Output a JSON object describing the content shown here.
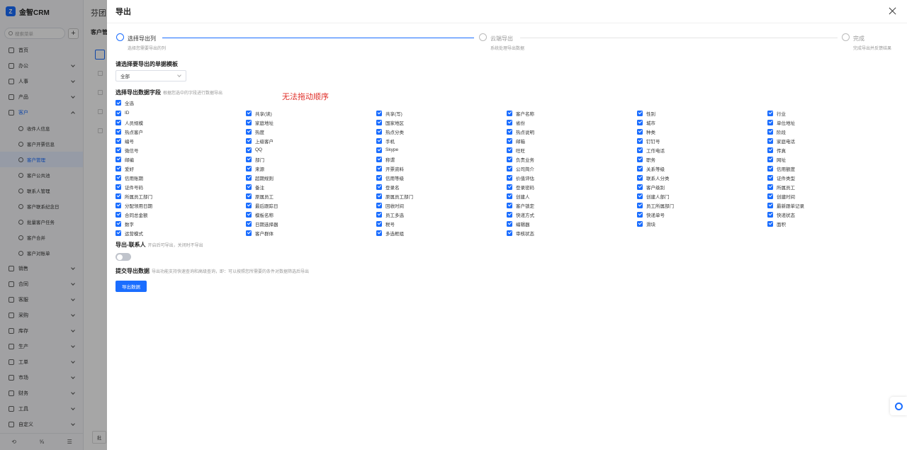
{
  "app": {
    "name": "金智CRM",
    "logo_text": "Z"
  },
  "sidebar": {
    "search_placeholder": "搜索菜单",
    "add_label": "+",
    "items": [
      {
        "label": "首页",
        "icon": "home-icon",
        "children": false,
        "expanded": false
      },
      {
        "label": "办公",
        "icon": "office-icon",
        "children": true,
        "expanded": false
      },
      {
        "label": "人事",
        "icon": "user-icon",
        "children": true,
        "expanded": false
      },
      {
        "label": "产品",
        "icon": "box-icon",
        "children": true,
        "expanded": false
      },
      {
        "label": "客户",
        "icon": "customer-icon",
        "children": true,
        "expanded": true,
        "active": true
      }
    ],
    "sub_items": [
      {
        "label": "收件人信息",
        "active": false
      },
      {
        "label": "客户开票信息",
        "active": false
      },
      {
        "label": "客户管理",
        "active": true
      },
      {
        "label": "客户公共池",
        "active": false
      },
      {
        "label": "联系人管理",
        "active": false
      },
      {
        "label": "客户联系纪念日",
        "active": false
      },
      {
        "label": "批量客户任务",
        "active": false
      },
      {
        "label": "客户合并",
        "active": false
      },
      {
        "label": "客户对账单",
        "active": false
      }
    ],
    "more_items": [
      "销售",
      "合同",
      "客服",
      "采购",
      "库存",
      "生产",
      "工单",
      "市场",
      "财务",
      "工具",
      "自定义"
    ],
    "bottom_icons": [
      "⟲",
      "⅝",
      "☰"
    ]
  },
  "background_page": {
    "title": "芬团",
    "subtitle": "客户管",
    "footer_btn": "批"
  },
  "drawer": {
    "title": "导出",
    "steps": [
      {
        "title": "选择导出列",
        "desc": "选择您需要导出的列",
        "status": "active"
      },
      {
        "title": "云端导出",
        "desc": "系统处理导出数据",
        "status": "wait"
      },
      {
        "title": "完成",
        "desc": "完成导出并反馈结果",
        "status": "wait"
      }
    ],
    "template_section": {
      "title": "请选择要导出的单据模板",
      "selected": "全部"
    },
    "fields_section": {
      "title": "选择导出数据字段",
      "hint": "根据您选中的字段进行数据导出",
      "select_all_label": "全选",
      "annotation": "无法拖动顺序",
      "fields": [
        "ID",
        "共享(读)",
        "共享(写)",
        "客户名称",
        "性别",
        "行业",
        "人员规模",
        "家庭地址",
        "国家地区",
        "省份",
        "城市",
        "单位地址",
        "热点客户",
        "热度",
        "热点分类",
        "热点说明",
        "种类",
        "阶段",
        "编号",
        "上级客户",
        "手机",
        "邮箱",
        "钉钉号",
        "家庭电话",
        "微信号",
        "QQ",
        "Skype",
        "旺旺",
        "工作电话",
        "传真",
        "邮编",
        "部门",
        "称谓",
        "负责业务",
        "职务",
        "网址",
        "爱好",
        "来源",
        "开票资料",
        "公司简介",
        "关系等级",
        "信用额度",
        "信用账期",
        "超期规则",
        "信用等级",
        "价值评估",
        "联系人分类",
        "证件类型",
        "证件号码",
        "备注",
        "登录名",
        "登录密码",
        "客户级别",
        "所属员工",
        "所属员工部门",
        "原属员工",
        "原属员工部门",
        "创建人",
        "创建人部门",
        "创建时间",
        "分配领用日期",
        "最后跟踪日",
        "回收时间",
        "客户锁定",
        "员工所属部门",
        "最新跟单记录",
        "合同总金额",
        "模板名称",
        "员工多选",
        "快递方式",
        "快递单号",
        "快递状态",
        "数字",
        "日期选择器",
        "税号",
        "编辑器",
        "滑块",
        "面积",
        "运营模式",
        "客户群体",
        "多选框组",
        "审核状态"
      ]
    },
    "contacts_section": {
      "title": "导出-联系人",
      "hint": "开启后可导出，关闭时不导出",
      "enabled": false
    },
    "submit_section": {
      "title": "提交导出数据",
      "hint": "导出功能支持快速查询和高级查询，即：可以按照您所需要的条件对数据筛选后导出",
      "button_label": "导出数据"
    },
    "colors": {
      "accent": "#1a6dff",
      "annotation": "#e0302a"
    }
  }
}
